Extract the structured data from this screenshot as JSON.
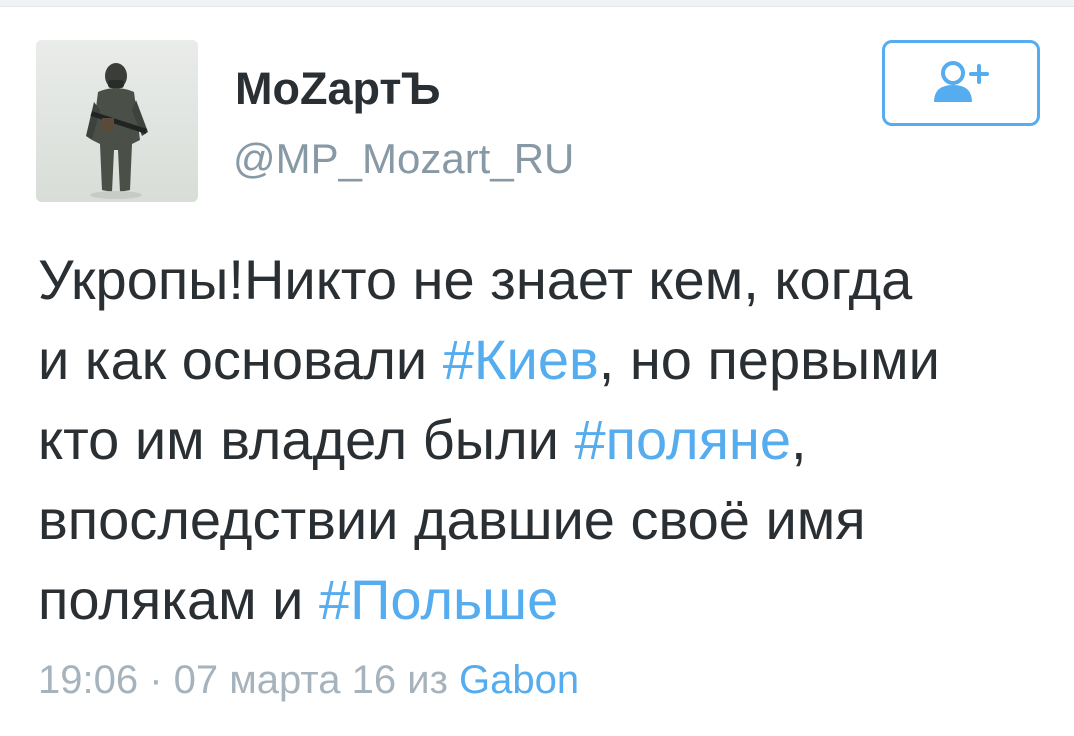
{
  "user": {
    "display_name": "MoZaртЪ",
    "handle": "@MP_Mozart_RU",
    "avatar_icon": "soldier-avatar-icon"
  },
  "follow_button": {
    "icon": "add-user-icon",
    "accent": "#55acee"
  },
  "tweet": {
    "line1": "Укропы!Никто не знает кем, когда",
    "line2_a": "и как основали ",
    "hashtag_kiev": "#Киев",
    "line2_b": ", но первыми",
    "line3_a": "кто им владел были ",
    "hashtag_polyane": "#поляне",
    "line3_b": ",",
    "line4": "впоследствии давшие своё имя",
    "line5_a": "полякам и ",
    "hashtag_polshe": "#Польше"
  },
  "meta": {
    "time": "19:06",
    "sep": " · ",
    "date": "07 марта 16",
    "from": " из ",
    "source": "Gabon"
  },
  "colors": {
    "text": "#292f33",
    "secondary": "#8899a6",
    "link": "#55acee"
  }
}
